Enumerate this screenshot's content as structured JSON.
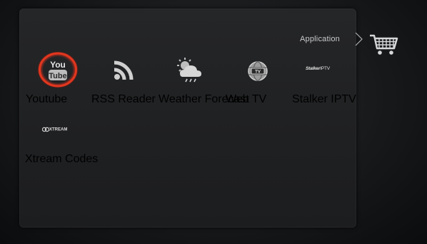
{
  "section": {
    "title": "Application"
  },
  "apps": [
    {
      "label": "Youtube",
      "icon": "youtube-icon",
      "selected": true
    },
    {
      "label": "RSS Reader",
      "icon": "rss-icon"
    },
    {
      "label": "Weather Forecast",
      "icon": "weather-icon"
    },
    {
      "label": "Web TV",
      "icon": "web-tv-icon"
    },
    {
      "label": "Stalker IPTV",
      "icon": "stalker-iptv-icon"
    },
    {
      "label": "Xtream Codes",
      "icon": "xtream-codes-icon"
    }
  ],
  "logos": {
    "youtube_top": "You",
    "youtube_bottom": "Tube",
    "stalker_bold": "Stalker",
    "stalker_rest": "IPTV",
    "xtream": "XTREAM"
  },
  "cart": {
    "icon": "shopping-cart-icon"
  },
  "colors": {
    "selection_ring": "#d8301e",
    "panel": "#222325",
    "label_text": "#d2d4d6"
  }
}
